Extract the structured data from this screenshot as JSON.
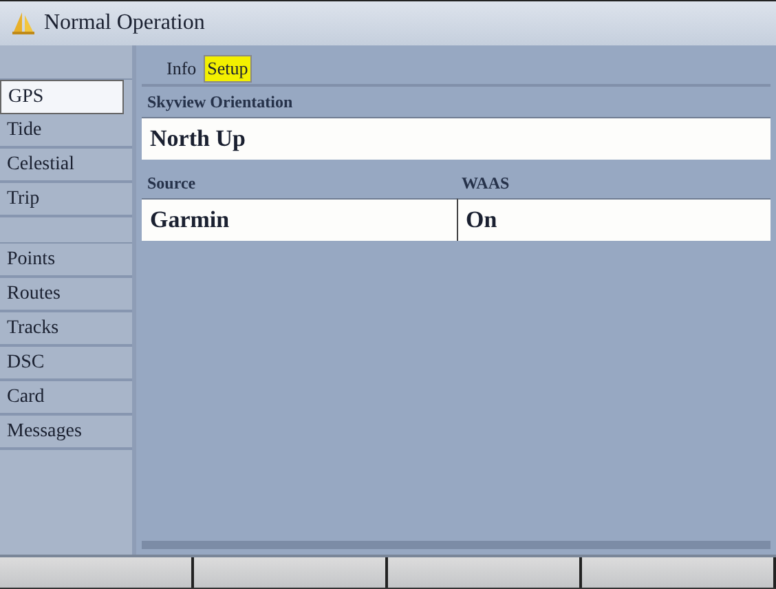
{
  "window": {
    "title": "Normal Operation"
  },
  "sidebar": {
    "groups": [
      {
        "items": [
          {
            "label": "GPS",
            "selected": true
          },
          {
            "label": "Tide",
            "selected": false
          },
          {
            "label": "Celestial",
            "selected": false
          },
          {
            "label": "Trip",
            "selected": false
          }
        ]
      },
      {
        "items": [
          {
            "label": "Points",
            "selected": false
          },
          {
            "label": "Routes",
            "selected": false
          },
          {
            "label": "Tracks",
            "selected": false
          },
          {
            "label": "DSC",
            "selected": false
          },
          {
            "label": "Card",
            "selected": false
          },
          {
            "label": "Messages",
            "selected": false
          }
        ]
      }
    ]
  },
  "tabs": [
    {
      "label": "Info",
      "selected": false
    },
    {
      "label": "Setup",
      "selected": true
    }
  ],
  "fields": [
    {
      "label": "Skyview Orientation",
      "value": "North Up"
    }
  ],
  "field_row": [
    {
      "label": "Source",
      "value": "Garmin"
    },
    {
      "label": "WAAS",
      "value": "On"
    }
  ]
}
